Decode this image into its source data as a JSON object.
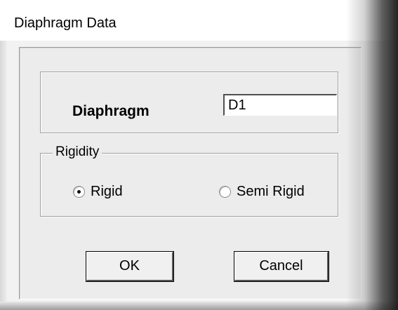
{
  "window": {
    "title": "Diaphragm Data"
  },
  "diaphragm": {
    "label": "Diaphragm",
    "value": "D1"
  },
  "rigidity": {
    "legend": "Rigidity",
    "options": [
      {
        "label": "Rigid",
        "selected": true
      },
      {
        "label": "Semi Rigid",
        "selected": false
      }
    ]
  },
  "buttons": {
    "ok_label": "OK",
    "cancel_label": "Cancel"
  }
}
